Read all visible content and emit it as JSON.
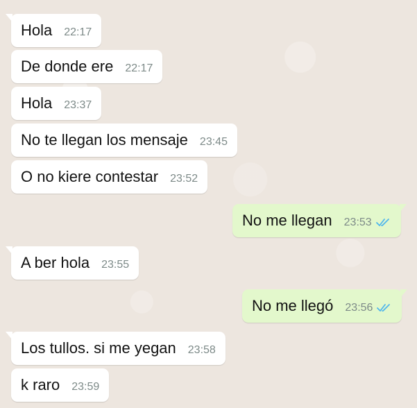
{
  "messages": [
    {
      "direction": "incoming",
      "text": "Hola",
      "time": "22:17"
    },
    {
      "direction": "incoming",
      "text": "De donde ere",
      "time": "22:17"
    },
    {
      "direction": "incoming",
      "text": "Hola",
      "time": "23:37"
    },
    {
      "direction": "incoming",
      "text": "No te llegan los mensaje",
      "time": "23:45"
    },
    {
      "direction": "incoming",
      "text": "O no kiere contestar",
      "time": "23:52"
    },
    {
      "direction": "outgoing",
      "text": "No me llegan",
      "time": "23:53",
      "status": "read"
    },
    {
      "direction": "incoming",
      "text": "A ber hola",
      "time": "23:55"
    },
    {
      "direction": "outgoing",
      "text": "No me llegó",
      "time": "23:56",
      "status": "read"
    },
    {
      "direction": "incoming",
      "text": "Los tullos. si me yegan",
      "time": "23:58"
    },
    {
      "direction": "incoming",
      "text": "k raro",
      "time": "23:59"
    }
  ],
  "colors": {
    "incoming_bubble": "#ffffff",
    "outgoing_bubble": "#e3f8cc",
    "read_ticks": "#4fb6ec",
    "background": "#ece5dd"
  },
  "icons": {
    "read_receipt": "double-check-icon"
  }
}
